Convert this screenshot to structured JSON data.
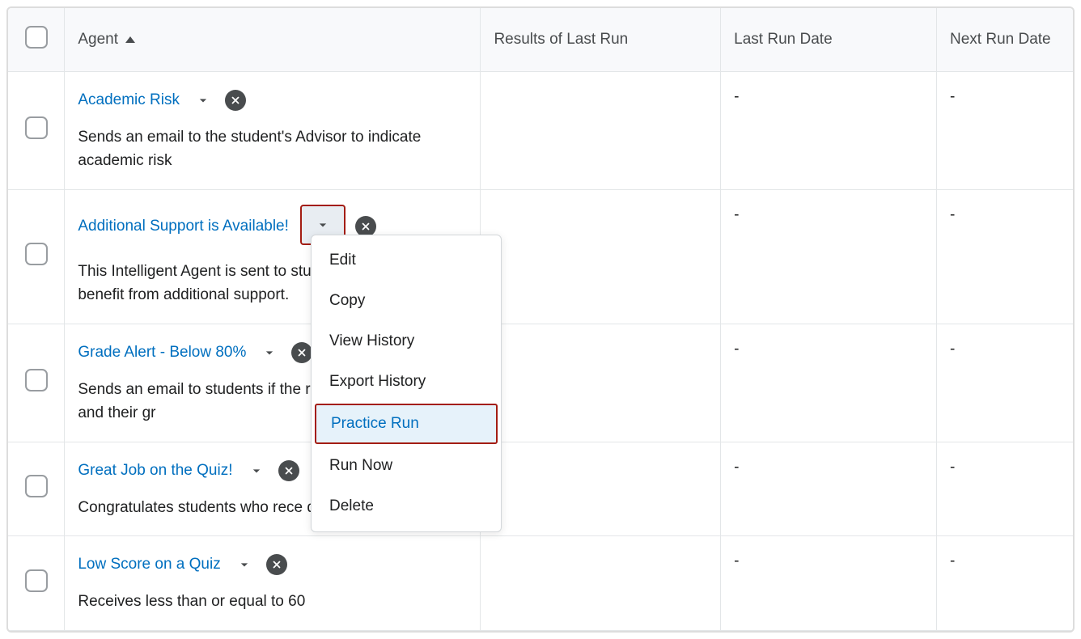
{
  "header": {
    "agent": "Agent",
    "results": "Results of Last Run",
    "last_run": "Last Run Date",
    "next_run": "Next Run Date"
  },
  "rows": [
    {
      "name": "Academic Risk",
      "desc": "Sends an email to the student's Advisor to indicate academic risk",
      "results": "",
      "last_run": "-",
      "next_run": "-",
      "chev_active": false
    },
    {
      "name": "Additional Support is Available!",
      "desc": "This Intelligent Agent is sent to students who might benefit from additional support.",
      "results": "",
      "last_run": "-",
      "next_run": "-",
      "chev_active": true
    },
    {
      "name": "Grade Alert - Below 80%",
      "desc": "Sends an email to students if the recieve a grade alert and their gr",
      "results": "",
      "last_run": "-",
      "next_run": "-",
      "chev_active": false
    },
    {
      "name": "Great Job on the Quiz!",
      "desc": "Congratulates students who rece quiz",
      "results": "",
      "last_run": "-",
      "next_run": "-",
      "chev_active": false
    },
    {
      "name": "Low Score on a Quiz",
      "desc": "Receives less than or equal to 60",
      "results": "",
      "last_run": "-",
      "next_run": "-",
      "chev_active": false
    }
  ],
  "menu": {
    "edit": "Edit",
    "copy": "Copy",
    "view_history": "View History",
    "export_history": "Export History",
    "practice_run": "Practice Run",
    "run_now": "Run Now",
    "delete": "Delete"
  }
}
